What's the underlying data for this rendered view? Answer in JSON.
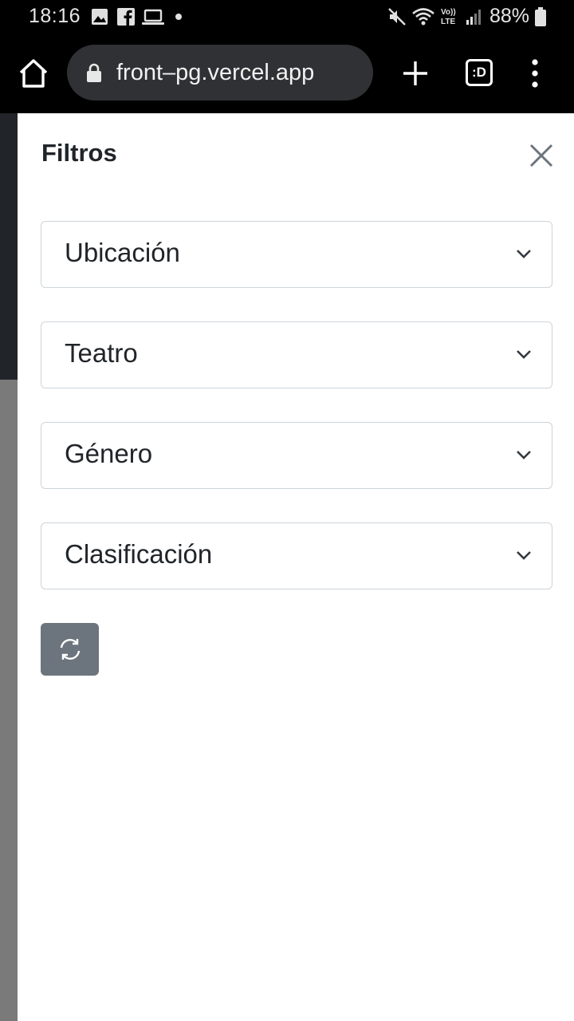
{
  "status_bar": {
    "time": "18:16",
    "battery": "88%",
    "icons": [
      "gallery-icon",
      "facebook-icon",
      "laptop-icon",
      "dot-icon",
      "mute-icon",
      "wifi-icon",
      "volte-icon",
      "signal-icon",
      "battery-icon"
    ]
  },
  "browser": {
    "url": "front–pg.vercel.app",
    "tab_count": ":D"
  },
  "panel": {
    "title": "Filtros",
    "filters": [
      {
        "label": "Ubicación"
      },
      {
        "label": "Teatro"
      },
      {
        "label": "Género"
      },
      {
        "label": "Clasificación"
      }
    ],
    "reset_icon": "refresh-icon"
  },
  "colors": {
    "accent_button": "#6c757d",
    "border": "#ced4da",
    "text": "#212529"
  }
}
